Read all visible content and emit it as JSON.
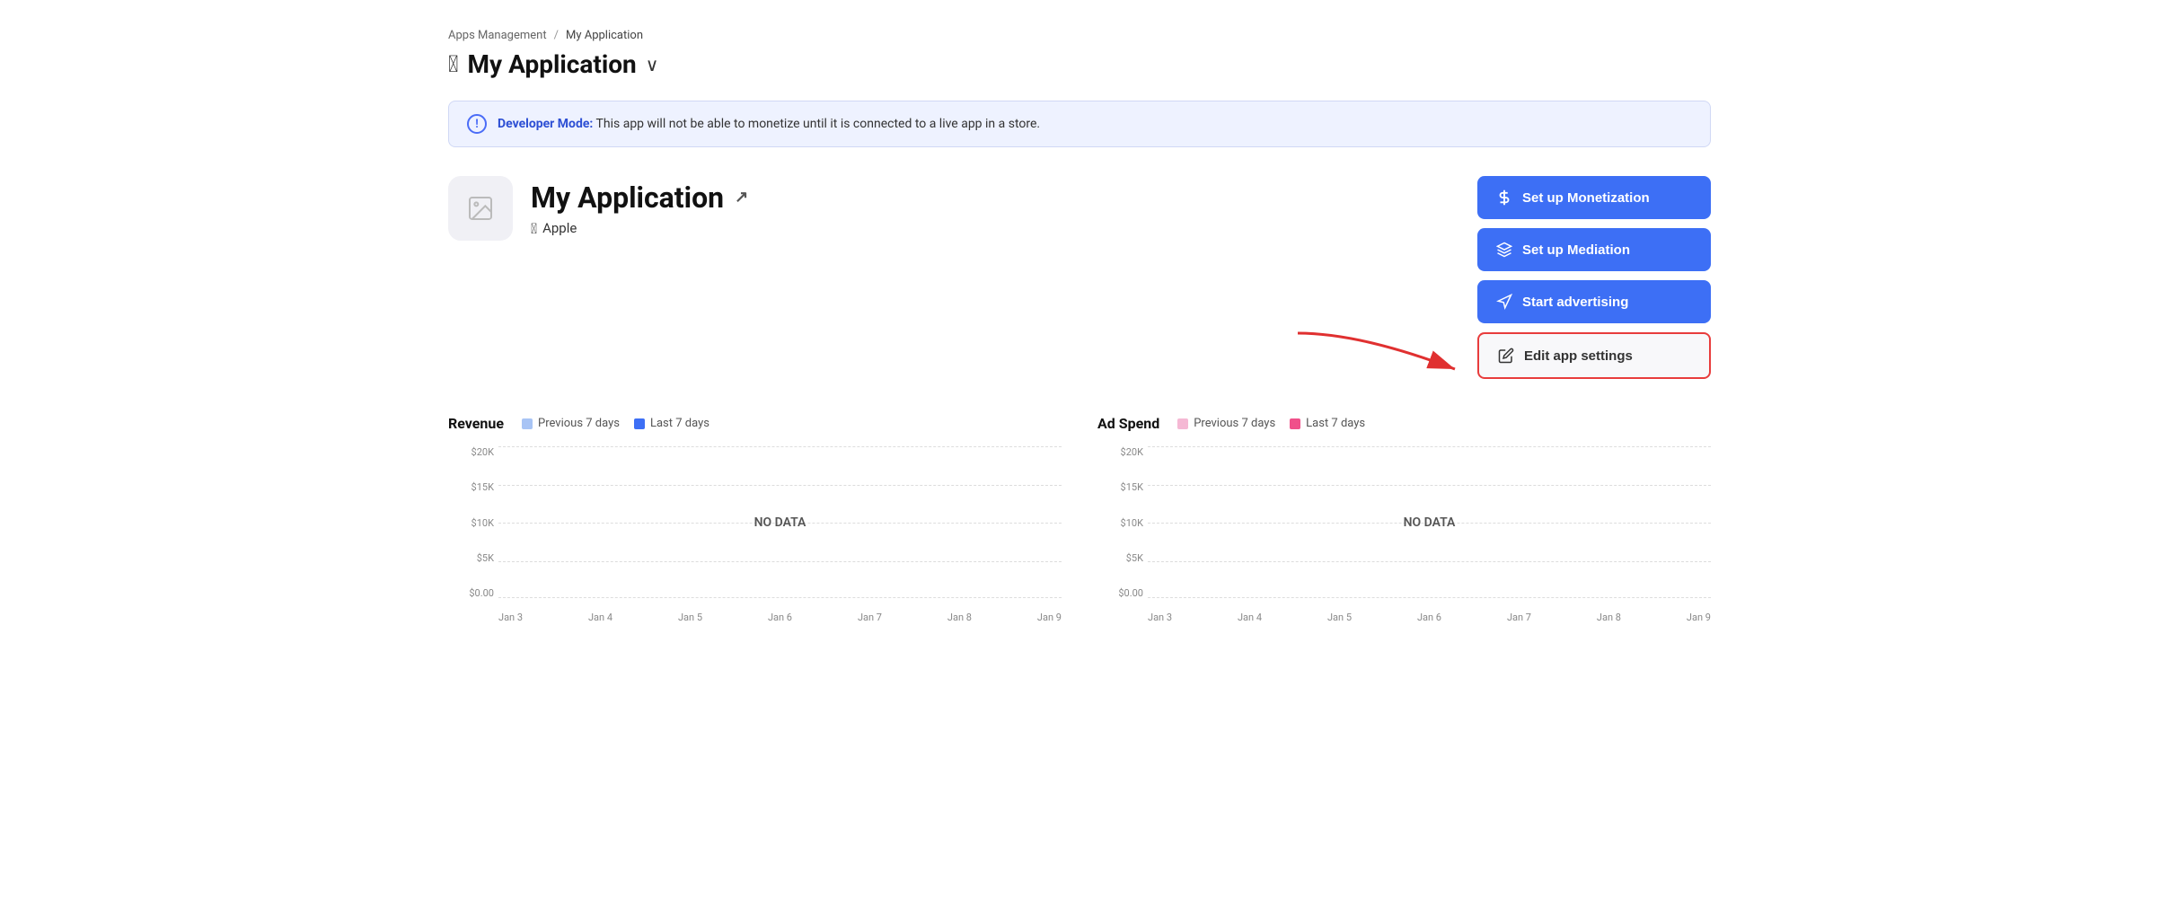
{
  "breadcrumb": {
    "parent_label": "Apps Management",
    "separator": "/",
    "current_label": "My Application"
  },
  "page_title": "My Application",
  "chevron": "∨",
  "dev_banner": {
    "icon_text": "!",
    "text_bold": "Developer Mode:",
    "text_normal": " This app will not be able to monetize until it is connected to a live app in a store."
  },
  "app": {
    "name": "My Application",
    "platform": "Apple"
  },
  "buttons": {
    "monetization": "Set up Monetization",
    "mediation": "Set up Mediation",
    "advertising": "Start advertising",
    "edit_settings": "Edit app settings"
  },
  "revenue_chart": {
    "title": "Revenue",
    "legend": [
      {
        "label": "Previous 7 days",
        "color": "#a8c4f5"
      },
      {
        "label": "Last 7 days",
        "color": "#3d6ff5"
      }
    ],
    "no_data": "NO DATA",
    "y_labels": [
      "$20K",
      "$15K",
      "$10K",
      "$5K",
      "$0.00"
    ],
    "x_labels": [
      "Jan 3",
      "Jan 4",
      "Jan 5",
      "Jan 6",
      "Jan 7",
      "Jan 8",
      "Jan 9"
    ]
  },
  "ad_spend_chart": {
    "title": "Ad Spend",
    "legend": [
      {
        "label": "Previous 7 days",
        "color": "#f5b8d4"
      },
      {
        "label": "Last 7 days",
        "color": "#f0508a"
      }
    ],
    "no_data": "NO DATA",
    "y_labels": [
      "$20K",
      "$15K",
      "$10K",
      "$5K",
      "$0.00"
    ],
    "x_labels": [
      "Jan 3",
      "Jan 4",
      "Jan 5",
      "Jan 6",
      "Jan 7",
      "Jan 8",
      "Jan 9"
    ]
  }
}
